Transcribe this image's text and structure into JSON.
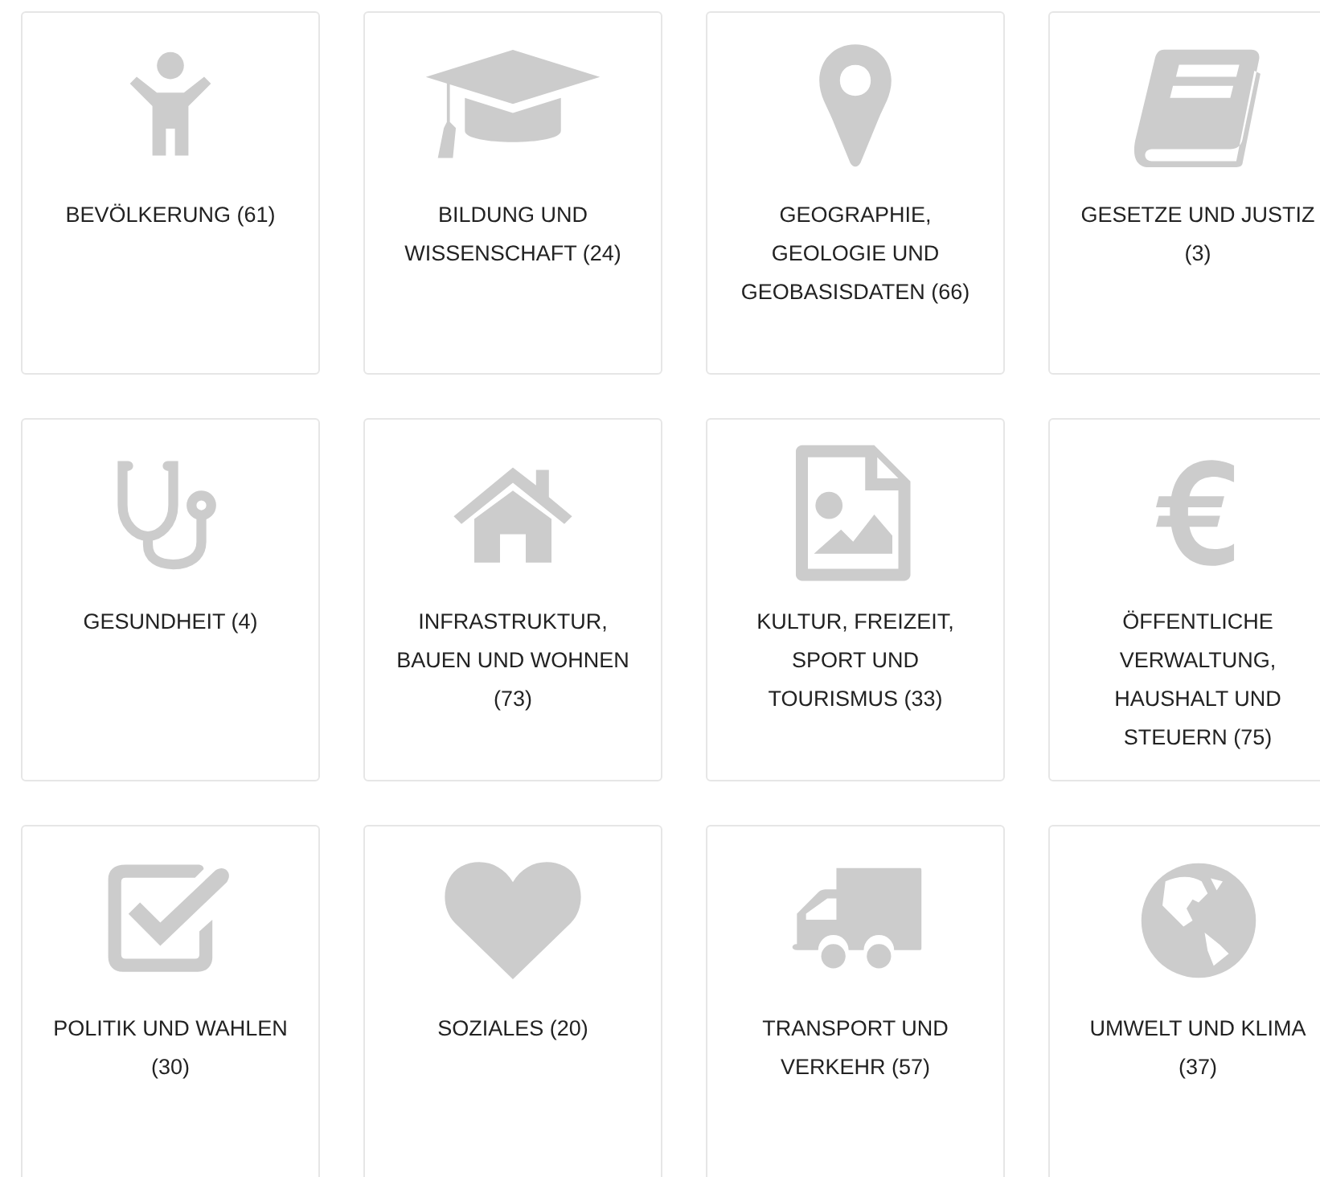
{
  "categories": [
    {
      "label": "BEVÖLKERUNG (61)"
    },
    {
      "label": "BILDUNG UND\nWISSENSCHAFT (24)"
    },
    {
      "label": "GEOGRAPHIE,\nGEOLOGIE UND\nGEOBASISDATEN (66)"
    },
    {
      "label": "GESETZE UND JUSTIZ\n(3)"
    },
    {
      "label": "GESUNDHEIT (4)"
    },
    {
      "label": "INFRASTRUKTUR,\nBAUEN UND WOHNEN\n(73)"
    },
    {
      "label": "KULTUR, FREIZEIT,\nSPORT UND\nTOURISMUS (33)"
    },
    {
      "label": "ÖFFENTLICHE\nVERWALTUNG,\nHAUSHALT UND\nSTEUERN (75)"
    },
    {
      "label": "POLITIK UND WAHLEN\n(30)"
    },
    {
      "label": "SOZIALES (20)"
    },
    {
      "label": "TRANSPORT UND\nVERKEHR (57)"
    },
    {
      "label": "UMWELT UND KLIMA\n(37)"
    }
  ]
}
